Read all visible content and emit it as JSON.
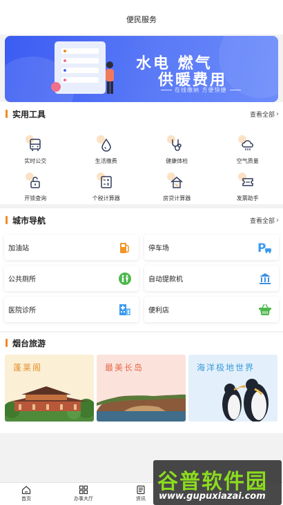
{
  "header": {
    "title": "便民服务"
  },
  "banner": {
    "line1": "水电 燃气",
    "line2": "供暖费用",
    "line3": "在线缴纳 方便快捷"
  },
  "tools": {
    "title": "实用工具",
    "more": "查看全部",
    "items": [
      {
        "label": "实时公交",
        "icon": "bus-icon"
      },
      {
        "label": "生活缴费",
        "icon": "water-drop-icon"
      },
      {
        "label": "健康体检",
        "icon": "stethoscope-icon"
      },
      {
        "label": "空气质量",
        "icon": "cloud-icon"
      },
      {
        "label": "开锁查询",
        "icon": "lock-icon"
      },
      {
        "label": "个税计算器",
        "icon": "calculator-icon"
      },
      {
        "label": "房贷计算器",
        "icon": "house-icon"
      },
      {
        "label": "发票助手",
        "icon": "ticket-icon"
      }
    ]
  },
  "nav": {
    "title": "城市导航",
    "more": "查看全部",
    "items": [
      {
        "label": "加油站",
        "icon": "fuel-pump-icon",
        "color": "#f0962b"
      },
      {
        "label": "停车场",
        "icon": "parking-icon",
        "color": "#3d9af0"
      },
      {
        "label": "公共厕所",
        "icon": "toilet-icon",
        "color": "#4cb84c"
      },
      {
        "label": "自动提款机",
        "icon": "bank-icon",
        "color": "#3d8fe0"
      },
      {
        "label": "医院诊所",
        "icon": "hospital-icon",
        "color": "#3d9af0"
      },
      {
        "label": "便利店",
        "icon": "basket-icon",
        "color": "#4cb84c"
      }
    ]
  },
  "tour": {
    "title": "烟台旅游",
    "items": [
      {
        "label": "蓬莱阁",
        "bg": "#fbefd6",
        "color": "#e5902a"
      },
      {
        "label": "最美长岛",
        "bg": "#fbe3dc",
        "color": "#e5694a"
      },
      {
        "label": "海洋极地世界",
        "bg": "#e3f0fb",
        "color": "#3a9ad8"
      }
    ]
  },
  "tabbar": {
    "items": [
      {
        "label": "首页"
      },
      {
        "label": "办事大厅"
      },
      {
        "label": "资讯"
      }
    ]
  },
  "watermark": {
    "big": "谷普软件园",
    "small": "www.gupuxiazai.com"
  },
  "colors": {
    "accent": "#f08a24",
    "banner": "#4a6cf5",
    "icon": "#2f3a5a"
  }
}
